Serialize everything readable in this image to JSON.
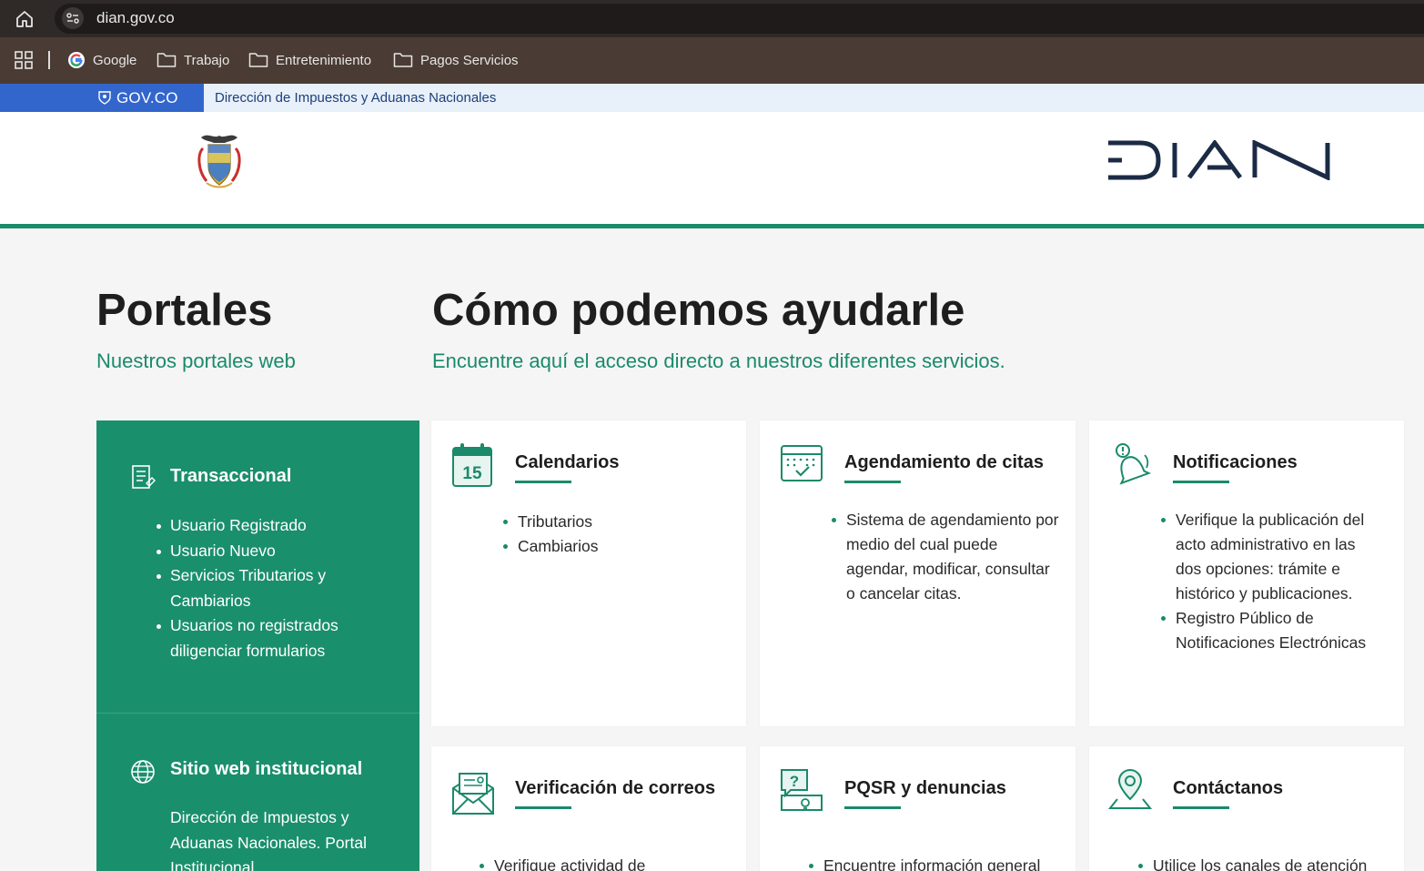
{
  "browser": {
    "url": "dian.gov.co",
    "bookmarks": [
      {
        "label": "Google",
        "icon": "google-icon"
      },
      {
        "label": "Trabajo",
        "icon": "folder-icon"
      },
      {
        "label": "Entretenimiento",
        "icon": "folder-icon"
      },
      {
        "label": "Pagos Servicios",
        "icon": "folder-icon"
      }
    ]
  },
  "govbar": {
    "logo_text": "GOV.CO",
    "entity": "Dirección de Impuestos y Aduanas Nacionales"
  },
  "header": {
    "logo_text": "DIAN"
  },
  "portales": {
    "title": "Portales",
    "subtitle": "Nuestros portales web",
    "panels": [
      {
        "title": "Transaccional",
        "icon": "document-icon",
        "items": [
          "Usuario Registrado",
          "Usuario Nuevo",
          "Servicios Tributarios y Cambiarios",
          "Usuarios no registrados diligenciar formularios"
        ]
      },
      {
        "title": "Sitio web institucional",
        "icon": "globe-icon",
        "text": "Dirección de Impuestos y Aduanas Nacionales. Portal Institucional"
      }
    ]
  },
  "ayuda": {
    "title": "Cómo podemos ayudarle",
    "subtitle": "Encuentre aquí el acceso directo a nuestros diferentes servicios.",
    "cards": [
      {
        "title": "Calendarios",
        "icon": "calendar-icon",
        "items": [
          "Tributarios",
          "Cambiarios"
        ]
      },
      {
        "title": "Agendamiento de citas",
        "icon": "appointment-calendar-icon",
        "items": [
          "Sistema de agendamiento por medio del cual puede agendar, modificar, consultar o cancelar citas."
        ]
      },
      {
        "title": "Notificaciones",
        "icon": "notification-bell-icon",
        "items": [
          "Verifique la publicación del acto administrativo en las dos opciones: trámite e histórico y publicaciones.",
          "Registro Público de Notificaciones Electrónicas"
        ]
      },
      {
        "title": "Verificación de correos",
        "icon": "envelope-icon",
        "items": [
          "Verifique actividad de"
        ]
      },
      {
        "title": "PQSR y denuncias",
        "icon": "question-chat-icon",
        "items": [
          "Encuentre información general"
        ]
      },
      {
        "title": "Contáctanos",
        "icon": "location-pin-icon",
        "items": [
          "Utilice los canales de atención"
        ]
      }
    ]
  },
  "colors": {
    "accent_green": "#1a8a6a",
    "gov_blue": "#3366cc",
    "dian_navy": "#1c2b45"
  }
}
